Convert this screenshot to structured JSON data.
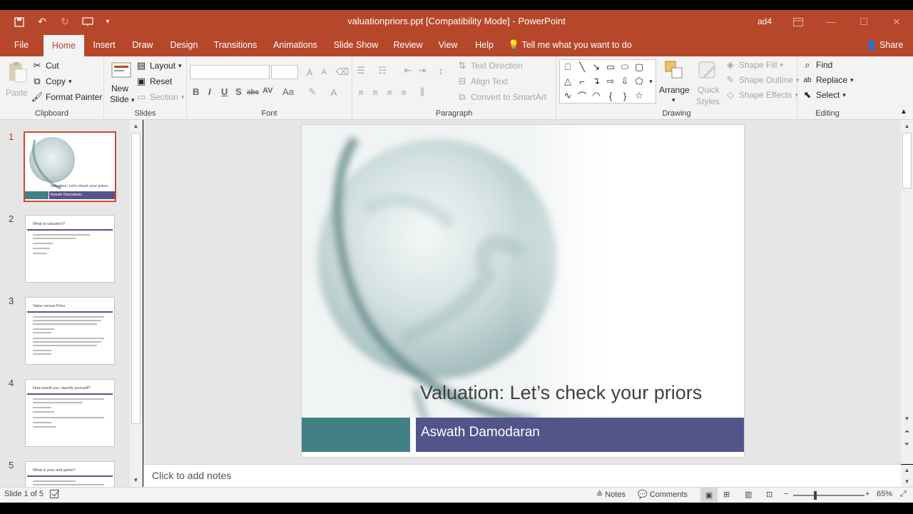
{
  "quick_access": {
    "save_icon": "save-icon",
    "undo_icon": "undo-icon",
    "redo_icon": "redo-icon",
    "present_icon": "present-from-start-icon",
    "customize_icon": "customize-qat-icon"
  },
  "window": {
    "title": "valuationpriors.ppt [Compatibility Mode]  -  PowerPoint",
    "user": "ad4"
  },
  "tabs": [
    {
      "label": "File"
    },
    {
      "label": "Home"
    },
    {
      "label": "Insert"
    },
    {
      "label": "Draw"
    },
    {
      "label": "Design"
    },
    {
      "label": "Transitions"
    },
    {
      "label": "Animations"
    },
    {
      "label": "Slide Show"
    },
    {
      "label": "Review"
    },
    {
      "label": "View"
    },
    {
      "label": "Help"
    }
  ],
  "tell_me": "Tell me what you want to do",
  "share": "Share",
  "ribbon": {
    "clipboard": {
      "label": "Clipboard",
      "paste": "Paste",
      "cut": "Cut",
      "copy": "Copy",
      "format_painter": "Format Painter"
    },
    "slides": {
      "label": "Slides",
      "new_slide_1": "New",
      "new_slide_2": "Slide",
      "layout": "Layout",
      "reset": "Reset",
      "section": "Section"
    },
    "font": {
      "label": "Font",
      "font_name": "",
      "font_size": "",
      "format_buttons": [
        "B",
        "I",
        "U",
        "S",
        "abc",
        "AV",
        "Aa"
      ]
    },
    "paragraph": {
      "label": "Paragraph",
      "text_direction": "Text Direction",
      "align_text": "Align Text",
      "smartart": "Convert to SmartArt"
    },
    "drawing": {
      "label": "Drawing",
      "arrange": "Arrange",
      "quick_styles_1": "Quick",
      "quick_styles_2": "Styles",
      "shape_fill": "Shape Fill",
      "shape_outline": "Shape Outline",
      "shape_effects": "Shape Effects"
    },
    "editing": {
      "label": "Editing",
      "find": "Find",
      "replace": "Replace",
      "select": "Select"
    }
  },
  "thumbnails": [
    {
      "number": "1",
      "title": "Valuation: Let's check your priors",
      "subtitle": "Aswath Damodaran"
    },
    {
      "number": "2",
      "title": "What is valuation?"
    },
    {
      "number": "3",
      "title": "Value versus Price"
    },
    {
      "number": "4",
      "title": "How would you classify yourself?"
    },
    {
      "number": "5",
      "title": "What is your end game?"
    }
  ],
  "slide": {
    "title": "Valuation: Let’s check your priors",
    "subtitle": "Aswath Damodaran"
  },
  "notes_placeholder": "Click to add notes",
  "status": {
    "slide_indicator": "Slide 1 of 5",
    "notes": "Notes",
    "comments": "Comments",
    "zoom": "65%",
    "zoom_level": 0.65
  },
  "colors": {
    "accent": "#b7472a",
    "teal_band": "#438086",
    "purple_band": "#53548a"
  }
}
